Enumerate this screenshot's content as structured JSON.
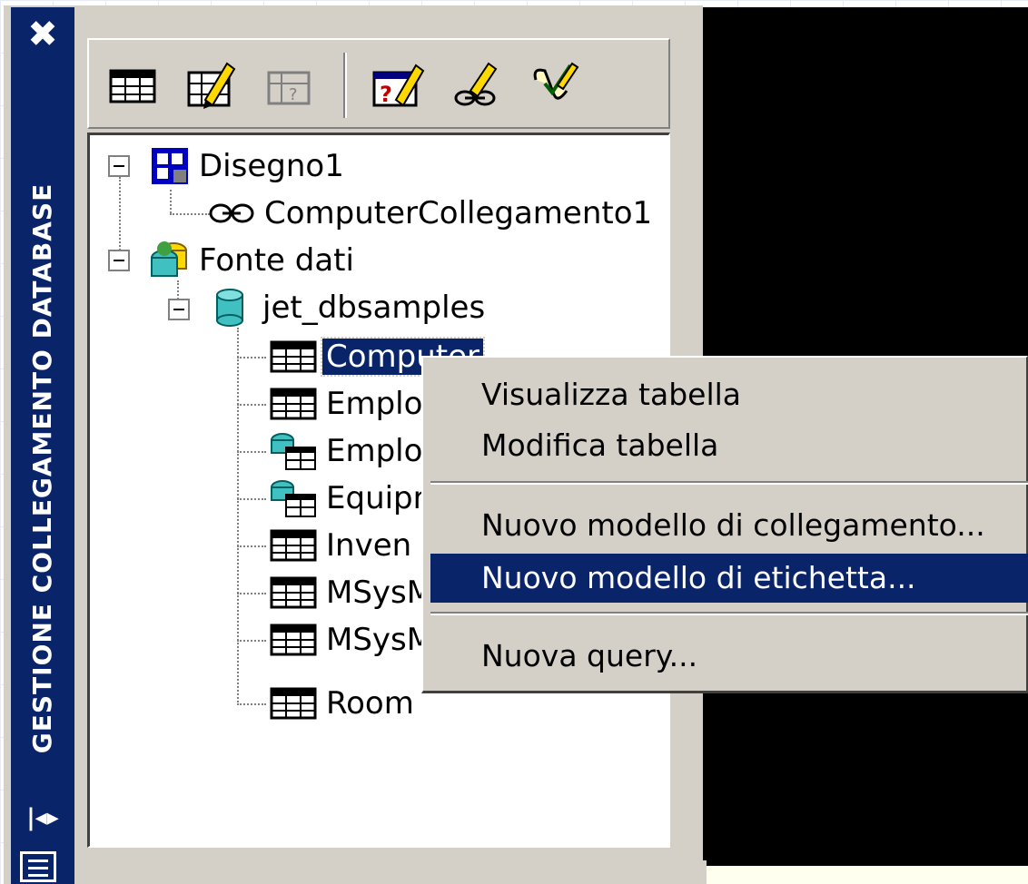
{
  "palette": {
    "side_title": "GESTIONE COLLEGAMENTO DATABASE",
    "close_glyph": "✖",
    "autohide_glyph": "|◂▸"
  },
  "toolbar": {
    "buttons": [
      {
        "icon": "data-view-table-icon"
      },
      {
        "icon": "edit-table-icon"
      },
      {
        "icon": "disabled-table-icon"
      },
      {
        "icon": "query-editor-icon"
      },
      {
        "icon": "link-template-icon"
      },
      {
        "icon": "synchronize-icon"
      }
    ]
  },
  "tree": {
    "drawing": "Disegno1",
    "link": "ComputerCollegamento1",
    "datasource_root": "Fonte dati",
    "database": "jet_dbsamples",
    "tables": [
      "Computer",
      "Emplo",
      "Emplo",
      "Equipr",
      "Inven",
      "MSysM",
      "MSysM",
      "Room"
    ]
  },
  "context_menu": {
    "items": [
      "Visualizza tabella",
      "Modifica tabella",
      "Nuovo modello di collegamento...",
      "Nuovo modello di etichetta...",
      "Nuova query..."
    ],
    "highlighted_index": 3
  },
  "colors": {
    "selection": "#0a246a",
    "face": "#d4d0c8",
    "canvas": "#000000"
  }
}
